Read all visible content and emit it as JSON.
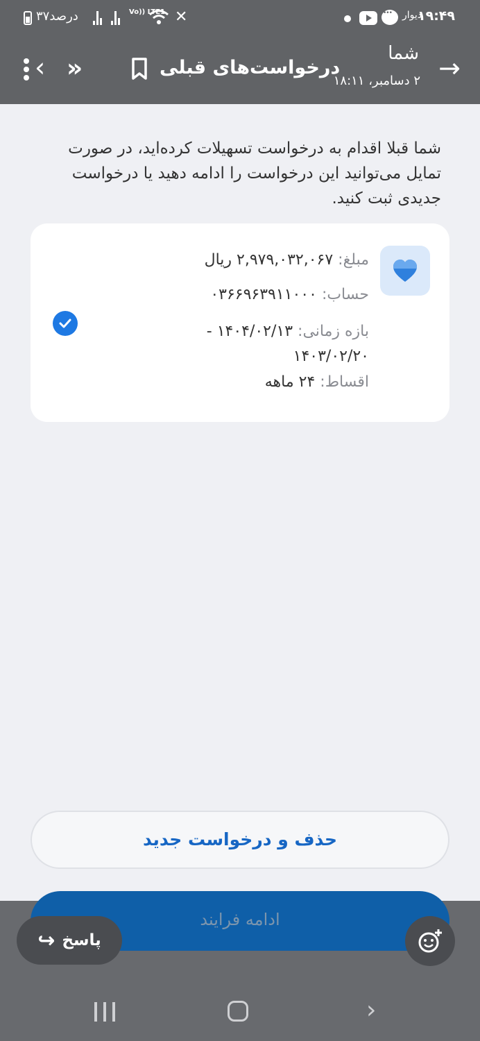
{
  "status_bar": {
    "time": "۱۹:۴۹",
    "battery_text": "۳۷درصد",
    "lte_label": "Vo)) LTE1",
    "divar_label": "دیوار",
    "icons": [
      "battery-icon",
      "signal-icon",
      "lte-icon",
      "wifi-icon",
      "mute-icon",
      "notification-dot-icon",
      "youtube-icon",
      "message-icon"
    ]
  },
  "app_bar": {
    "back_icon": "arrow-right-icon",
    "sender": "شما",
    "date": "۲ دسامبر، ۱۸:۱۱",
    "title": "درخواست‌های قبلی",
    "bookmark_icon": "bookmark-icon",
    "forward_icon": "forward-icon",
    "chevron_icon": "chevron-left-icon",
    "more_icon": "more-vertical-icon"
  },
  "intro_text": "شما قبلا اقدام به درخواست تسهیلات کرده‌اید، در صورت تمایل می‌توانید این درخواست را ادامه دهید یا درخواست جدیدی ثبت کنید.",
  "request_card": {
    "icon": "heart-icon",
    "amount_label": "مبلغ:",
    "amount_value": "۲,۹۷۹,۰۳۲,۰۶۷ ریال",
    "account_label": "حساب:",
    "account_value": "۰۳۶۶۹۶۳۹۱۱۰۰۰",
    "range_label": "بازه زمانی:",
    "range_value": "۱۴۰۴/۰۲/۱۳ - ۱۴۰۳/۰۲/۲۰",
    "installments_label": "اقساط:",
    "installments_value": "۲۴ ماهه",
    "selected": true,
    "colors": {
      "check": "#1e79e3",
      "icon_bg": "#dbe9fa"
    }
  },
  "buttons": {
    "delete_new": "حذف و درخواست جدید",
    "continue": "ادامه فرایند"
  },
  "overlay": {
    "reply_label": "پاسخ",
    "reply_icon": "reply-arrow-icon",
    "emoji_icon": "emoji-add-icon"
  },
  "nav_bar": {
    "icons": [
      "recents-icon",
      "home-icon",
      "back-icon"
    ]
  },
  "colors": {
    "header_bg": "#616366",
    "page_bg": "#eff0f4",
    "primary": "#0f5fa8",
    "link": "#1666c4"
  }
}
